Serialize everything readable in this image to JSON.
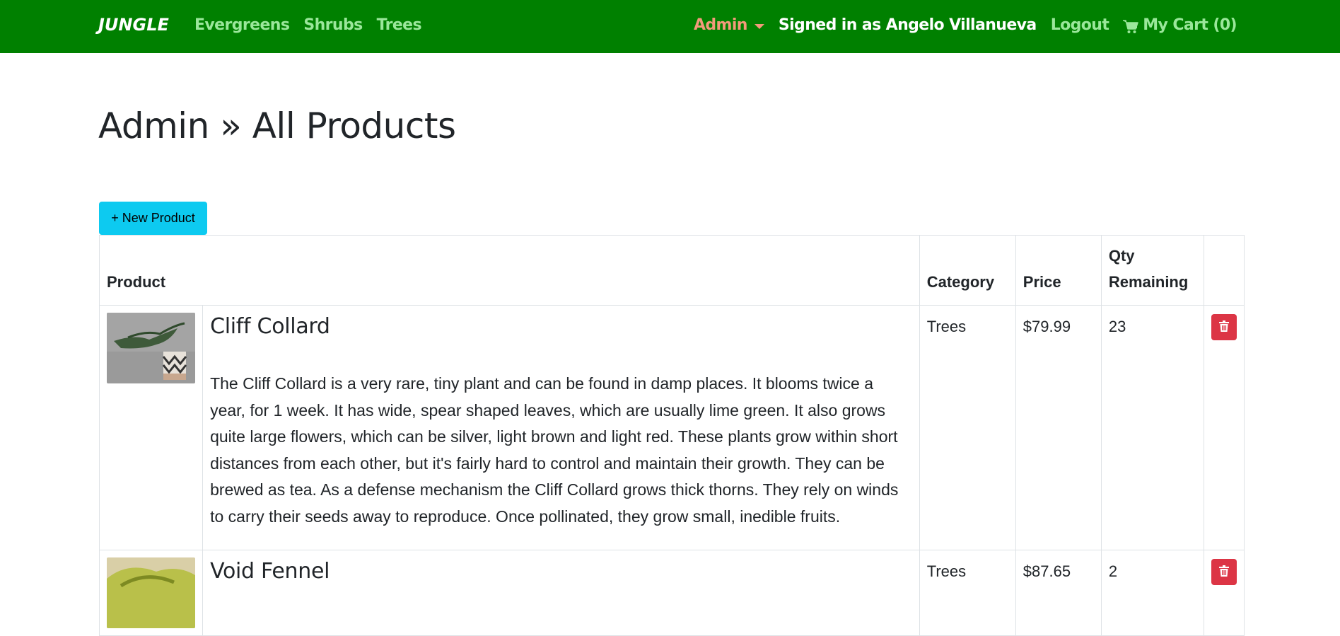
{
  "navbar": {
    "brand": "JUNGLE",
    "links": [
      "Evergreens",
      "Shrubs",
      "Trees"
    ],
    "admin_label": "Admin",
    "signed_in": "Signed in as Angelo Villanueva",
    "logout": "Logout",
    "cart": "My Cart (0)",
    "icons": {
      "caret": "chevron-down-icon",
      "cart": "shopping-cart-icon"
    },
    "colors": {
      "bar": "#008000",
      "link": "#9be79b",
      "admin": "#f39a7b"
    }
  },
  "page": {
    "title": "Admin » All Products"
  },
  "actions": {
    "new_product": "+ New Product",
    "color": "#0dcaf0"
  },
  "table": {
    "headers": {
      "product": "Product",
      "category": "Category",
      "price": "Price",
      "qty_line1": "Qty",
      "qty_line2": "Remaining"
    },
    "rows": [
      {
        "name": "Cliff Collard",
        "description": "The Cliff Collard is a very rare, tiny plant and can be found in damp places. It blooms twice a year, for 1 week. It has wide, spear shaped leaves, which are usually lime green. It also grows quite large flowers, which can be silver, light brown and light red. These plants grow within short distances from each other, but it's fairly hard to control and maintain their growth. They can be brewed as tea. As a defense mechanism the Cliff Collard grows thick thorns. They rely on winds to carry their seeds away to reproduce. Once pollinated, they grow small, inedible fruits.",
        "category": "Trees",
        "price": "$79.99",
        "qty": "23"
      },
      {
        "name": "Void Fennel",
        "category": "Trees",
        "price": "$87.65",
        "qty": "2"
      }
    ],
    "delete_icon": "trash-icon",
    "delete_color": "#dc3545"
  }
}
